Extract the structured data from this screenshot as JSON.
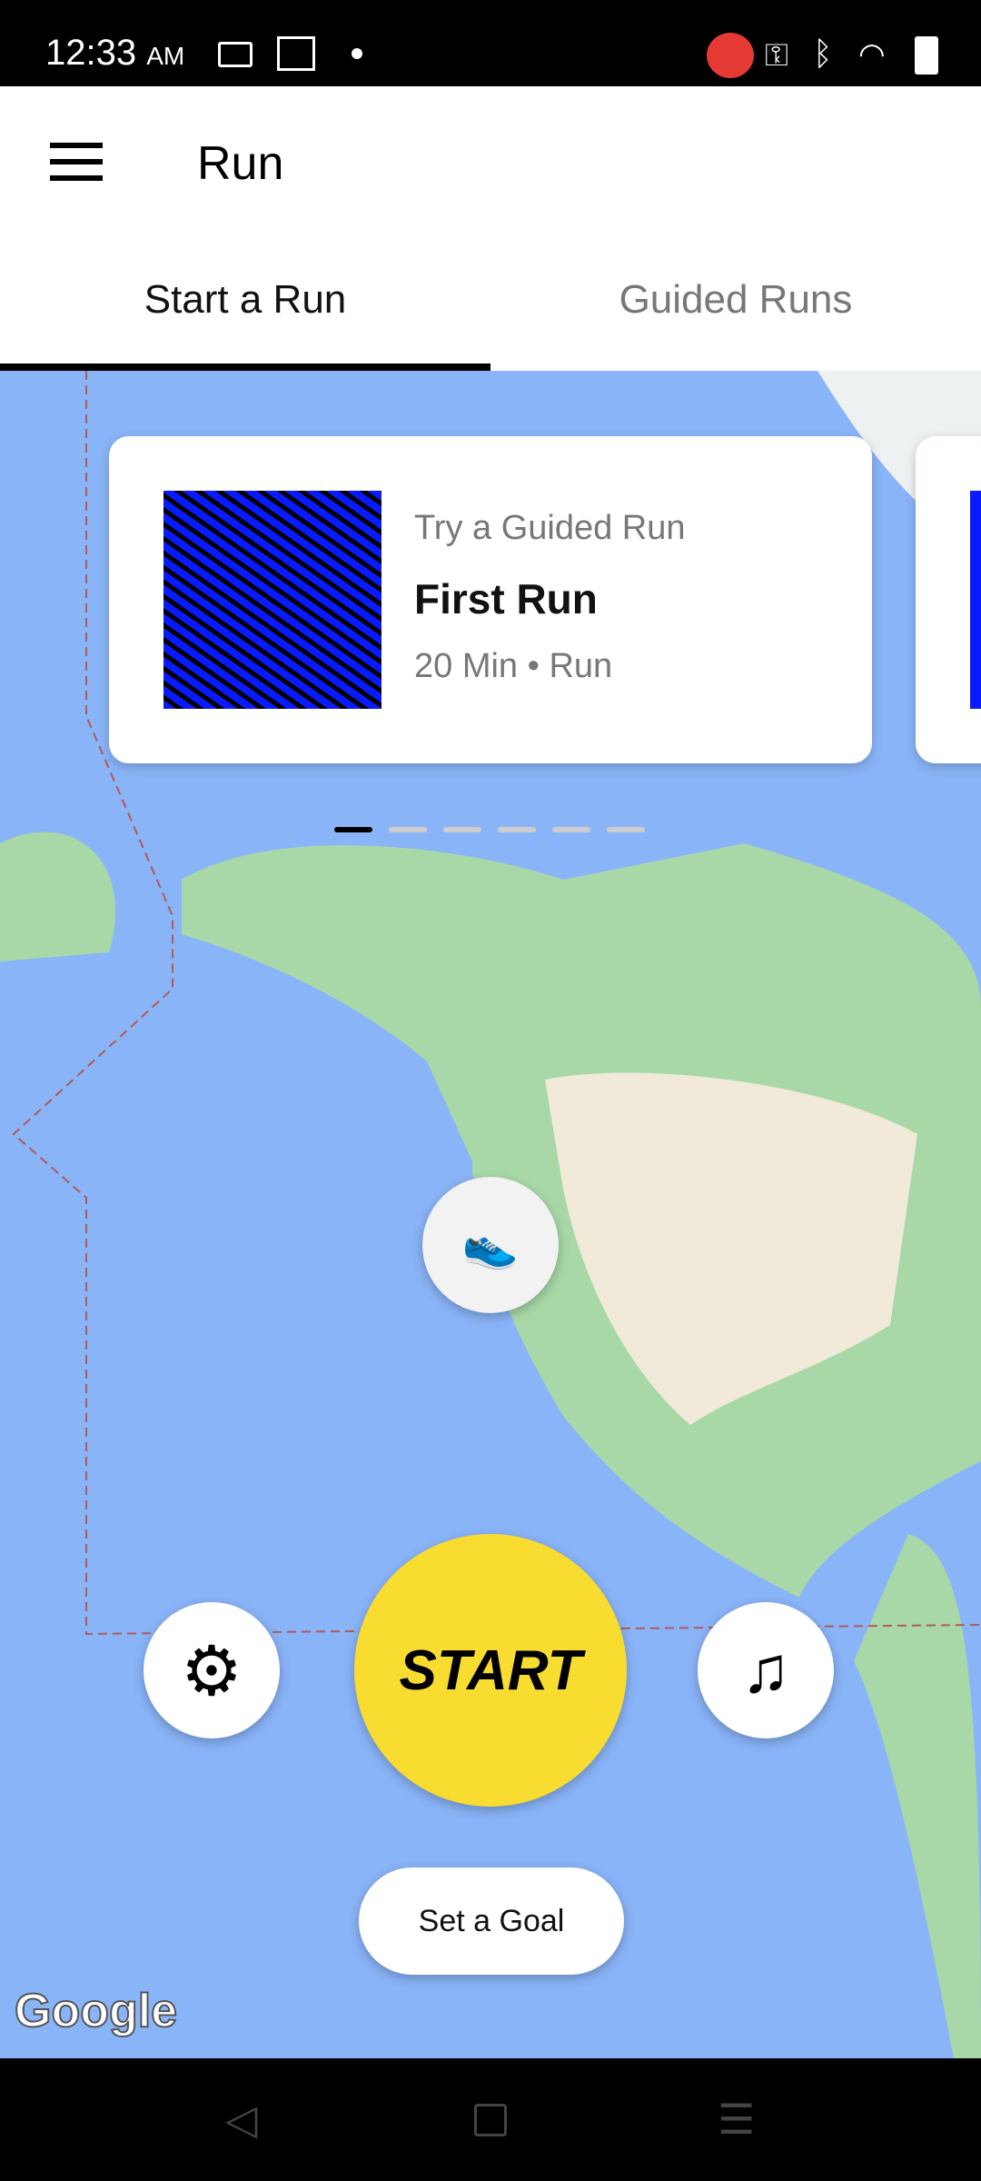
{
  "status_bar": {
    "time": "12:33",
    "ampm": "AM"
  },
  "app_bar": {
    "title": "Run"
  },
  "tabs": [
    {
      "label": "Start a Run",
      "active": true
    },
    {
      "label": "Guided Runs",
      "active": false
    }
  ],
  "guided_card": {
    "eyebrow": "Try a Guided Run",
    "title": "First Run",
    "meta": "20 Min • Run"
  },
  "carousel": {
    "pages": 6,
    "active": 1
  },
  "controls": {
    "start_label": "START",
    "goal_label": "Set a Goal"
  },
  "map": {
    "attribution": "Google"
  },
  "colors": {
    "start": "#f9dc30",
    "water": "#8ab4f8",
    "card_art": "#0a1aff"
  }
}
